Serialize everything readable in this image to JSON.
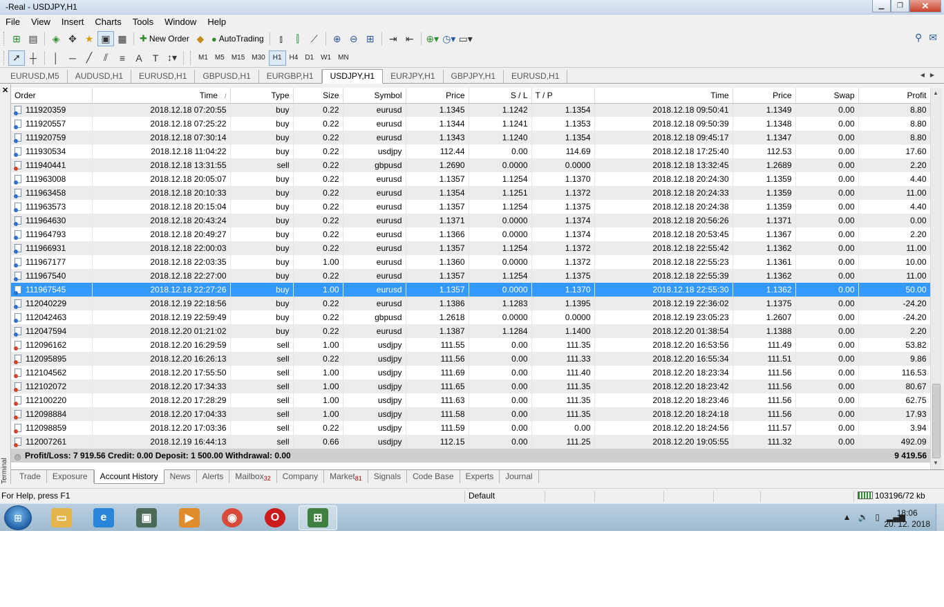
{
  "window": {
    "title": "-Real - USDJPY,H1"
  },
  "menu": [
    "File",
    "View",
    "Insert",
    "Charts",
    "Tools",
    "Window",
    "Help"
  ],
  "toolbar": {
    "new_order": "New Order",
    "autotrading": "AutoTrading"
  },
  "timeframes": [
    "M1",
    "M5",
    "M15",
    "M30",
    "H1",
    "H4",
    "D1",
    "W1",
    "MN"
  ],
  "timeframe_selected": "H1",
  "chart_tabs": [
    "EURUSD,M5",
    "AUDUSD,H1",
    "EURUSD,H1",
    "GBPUSD,H1",
    "EURGBP,H1",
    "USDJPY,H1",
    "EURJPY,H1",
    "GBPJPY,H1",
    "EURUSD,H1"
  ],
  "chart_tab_active": 5,
  "columns": [
    "Order",
    "Time",
    "Type",
    "Size",
    "Symbol",
    "Price",
    "S / L",
    "T / P",
    "Time",
    "Price",
    "Swap",
    "Profit"
  ],
  "sort_indicator": "/",
  "orders": [
    [
      "111920359",
      "2018.12.18 07:20:55",
      "buy",
      "0.22",
      "eurusd",
      "1.1345",
      "1.1242",
      "1.1354",
      "2018.12.18 09:50:41",
      "1.1349",
      "0.00",
      "8.80"
    ],
    [
      "111920557",
      "2018.12.18 07:25:22",
      "buy",
      "0.22",
      "eurusd",
      "1.1344",
      "1.1241",
      "1.1353",
      "2018.12.18 09:50:39",
      "1.1348",
      "0.00",
      "8.80"
    ],
    [
      "111920759",
      "2018.12.18 07:30:14",
      "buy",
      "0.22",
      "eurusd",
      "1.1343",
      "1.1240",
      "1.1354",
      "2018.12.18 09:45:17",
      "1.1347",
      "0.00",
      "8.80"
    ],
    [
      "111930534",
      "2018.12.18 11:04:22",
      "buy",
      "0.22",
      "usdjpy",
      "112.44",
      "0.00",
      "114.69",
      "2018.12.18 17:25:40",
      "112.53",
      "0.00",
      "17.60"
    ],
    [
      "111940441",
      "2018.12.18 13:31:55",
      "sell",
      "0.22",
      "gbpusd",
      "1.2690",
      "0.0000",
      "0.0000",
      "2018.12.18 13:32:45",
      "1.2689",
      "0.00",
      "2.20"
    ],
    [
      "111963008",
      "2018.12.18 20:05:07",
      "buy",
      "0.22",
      "eurusd",
      "1.1357",
      "1.1254",
      "1.1370",
      "2018.12.18 20:24:30",
      "1.1359",
      "0.00",
      "4.40"
    ],
    [
      "111963458",
      "2018.12.18 20:10:33",
      "buy",
      "0.22",
      "eurusd",
      "1.1354",
      "1.1251",
      "1.1372",
      "2018.12.18 20:24:33",
      "1.1359",
      "0.00",
      "11.00"
    ],
    [
      "111963573",
      "2018.12.18 20:15:04",
      "buy",
      "0.22",
      "eurusd",
      "1.1357",
      "1.1254",
      "1.1375",
      "2018.12.18 20:24:38",
      "1.1359",
      "0.00",
      "4.40"
    ],
    [
      "111964630",
      "2018.12.18 20:43:24",
      "buy",
      "0.22",
      "eurusd",
      "1.1371",
      "0.0000",
      "1.1374",
      "2018.12.18 20:56:26",
      "1.1371",
      "0.00",
      "0.00"
    ],
    [
      "111964793",
      "2018.12.18 20:49:27",
      "buy",
      "0.22",
      "eurusd",
      "1.1366",
      "0.0000",
      "1.1374",
      "2018.12.18 20:53:45",
      "1.1367",
      "0.00",
      "2.20"
    ],
    [
      "111966931",
      "2018.12.18 22:00:03",
      "buy",
      "0.22",
      "eurusd",
      "1.1357",
      "1.1254",
      "1.1372",
      "2018.12.18 22:55:42",
      "1.1362",
      "0.00",
      "11.00"
    ],
    [
      "111967177",
      "2018.12.18 22:03:35",
      "buy",
      "1.00",
      "eurusd",
      "1.1360",
      "0.0000",
      "1.1372",
      "2018.12.18 22:55:23",
      "1.1361",
      "0.00",
      "10.00"
    ],
    [
      "111967540",
      "2018.12.18 22:27:00",
      "buy",
      "0.22",
      "eurusd",
      "1.1357",
      "1.1254",
      "1.1375",
      "2018.12.18 22:55:39",
      "1.1362",
      "0.00",
      "11.00"
    ],
    [
      "111967545",
      "2018.12.18 22:27:26",
      "buy",
      "1.00",
      "eurusd",
      "1.1357",
      "0.0000",
      "1.1370",
      "2018.12.18 22:55:30",
      "1.1362",
      "0.00",
      "50.00"
    ],
    [
      "112040229",
      "2018.12.19 22:18:56",
      "buy",
      "0.22",
      "eurusd",
      "1.1386",
      "1.1283",
      "1.1395",
      "2018.12.19 22:36:02",
      "1.1375",
      "0.00",
      "-24.20"
    ],
    [
      "112042463",
      "2018.12.19 22:59:49",
      "buy",
      "0.22",
      "gbpusd",
      "1.2618",
      "0.0000",
      "0.0000",
      "2018.12.19 23:05:23",
      "1.2607",
      "0.00",
      "-24.20"
    ],
    [
      "112047594",
      "2018.12.20 01:21:02",
      "buy",
      "0.22",
      "eurusd",
      "1.1387",
      "1.1284",
      "1.1400",
      "2018.12.20 01:38:54",
      "1.1388",
      "0.00",
      "2.20"
    ],
    [
      "112096162",
      "2018.12.20 16:29:59",
      "sell",
      "1.00",
      "usdjpy",
      "111.55",
      "0.00",
      "111.35",
      "2018.12.20 16:53:56",
      "111.49",
      "0.00",
      "53.82"
    ],
    [
      "112095895",
      "2018.12.20 16:26:13",
      "sell",
      "0.22",
      "usdjpy",
      "111.56",
      "0.00",
      "111.33",
      "2018.12.20 16:55:34",
      "111.51",
      "0.00",
      "9.86"
    ],
    [
      "112104562",
      "2018.12.20 17:55:50",
      "sell",
      "1.00",
      "usdjpy",
      "111.69",
      "0.00",
      "111.40",
      "2018.12.20 18:23:34",
      "111.56",
      "0.00",
      "116.53"
    ],
    [
      "112102072",
      "2018.12.20 17:34:33",
      "sell",
      "1.00",
      "usdjpy",
      "111.65",
      "0.00",
      "111.35",
      "2018.12.20 18:23:42",
      "111.56",
      "0.00",
      "80.67"
    ],
    [
      "112100220",
      "2018.12.20 17:28:29",
      "sell",
      "1.00",
      "usdjpy",
      "111.63",
      "0.00",
      "111.35",
      "2018.12.20 18:23:46",
      "111.56",
      "0.00",
      "62.75"
    ],
    [
      "112098884",
      "2018.12.20 17:04:33",
      "sell",
      "1.00",
      "usdjpy",
      "111.58",
      "0.00",
      "111.35",
      "2018.12.20 18:24:18",
      "111.56",
      "0.00",
      "17.93"
    ],
    [
      "112098859",
      "2018.12.20 17:03:36",
      "sell",
      "0.22",
      "usdjpy",
      "111.59",
      "0.00",
      "0.00",
      "2018.12.20 18:24:56",
      "111.57",
      "0.00",
      "3.94"
    ],
    [
      "112007261",
      "2018.12.19 16:44:13",
      "sell",
      "0.66",
      "usdjpy",
      "112.15",
      "0.00",
      "111.25",
      "2018.12.20 19:05:55",
      "111.32",
      "0.00",
      "492.09"
    ]
  ],
  "selected_order": "111967545",
  "summary": {
    "text": "Profit/Loss: 7 919.56  Credit: 0.00  Deposit: 1 500.00  Withdrawal: 0.00",
    "total": "9 419.56"
  },
  "terminal_label": "Terminal",
  "bottom_tabs": [
    {
      "label": "Trade",
      "badge": ""
    },
    {
      "label": "Exposure",
      "badge": ""
    },
    {
      "label": "Account History",
      "badge": ""
    },
    {
      "label": "News",
      "badge": ""
    },
    {
      "label": "Alerts",
      "badge": ""
    },
    {
      "label": "Mailbox",
      "badge": "32"
    },
    {
      "label": "Company",
      "badge": ""
    },
    {
      "label": "Market",
      "badge": "81"
    },
    {
      "label": "Signals",
      "badge": ""
    },
    {
      "label": "Code Base",
      "badge": ""
    },
    {
      "label": "Experts",
      "badge": ""
    },
    {
      "label": "Journal",
      "badge": ""
    }
  ],
  "bottom_tab_active": 2,
  "status": {
    "help": "For Help, press F1",
    "profile": "Default",
    "connection": "103196/72 kb"
  },
  "taskbar": {
    "apps": [
      {
        "name": "explorer",
        "color": "#e3b54a"
      },
      {
        "name": "internet-explorer",
        "color": "#2a86d8"
      },
      {
        "name": "media-center",
        "color": "#4d6a58"
      },
      {
        "name": "media-player",
        "color": "#e08b2c"
      },
      {
        "name": "chrome",
        "color": "#d84a3a"
      },
      {
        "name": "opera",
        "color": "#cc1b1b"
      },
      {
        "name": "metatrader",
        "color": "#3f7f3f"
      }
    ],
    "clock_time": "18:06",
    "clock_date": "20. 12. 2018"
  },
  "colors": {
    "selected_row": "#3399ff",
    "accent_red": "#c00000"
  }
}
